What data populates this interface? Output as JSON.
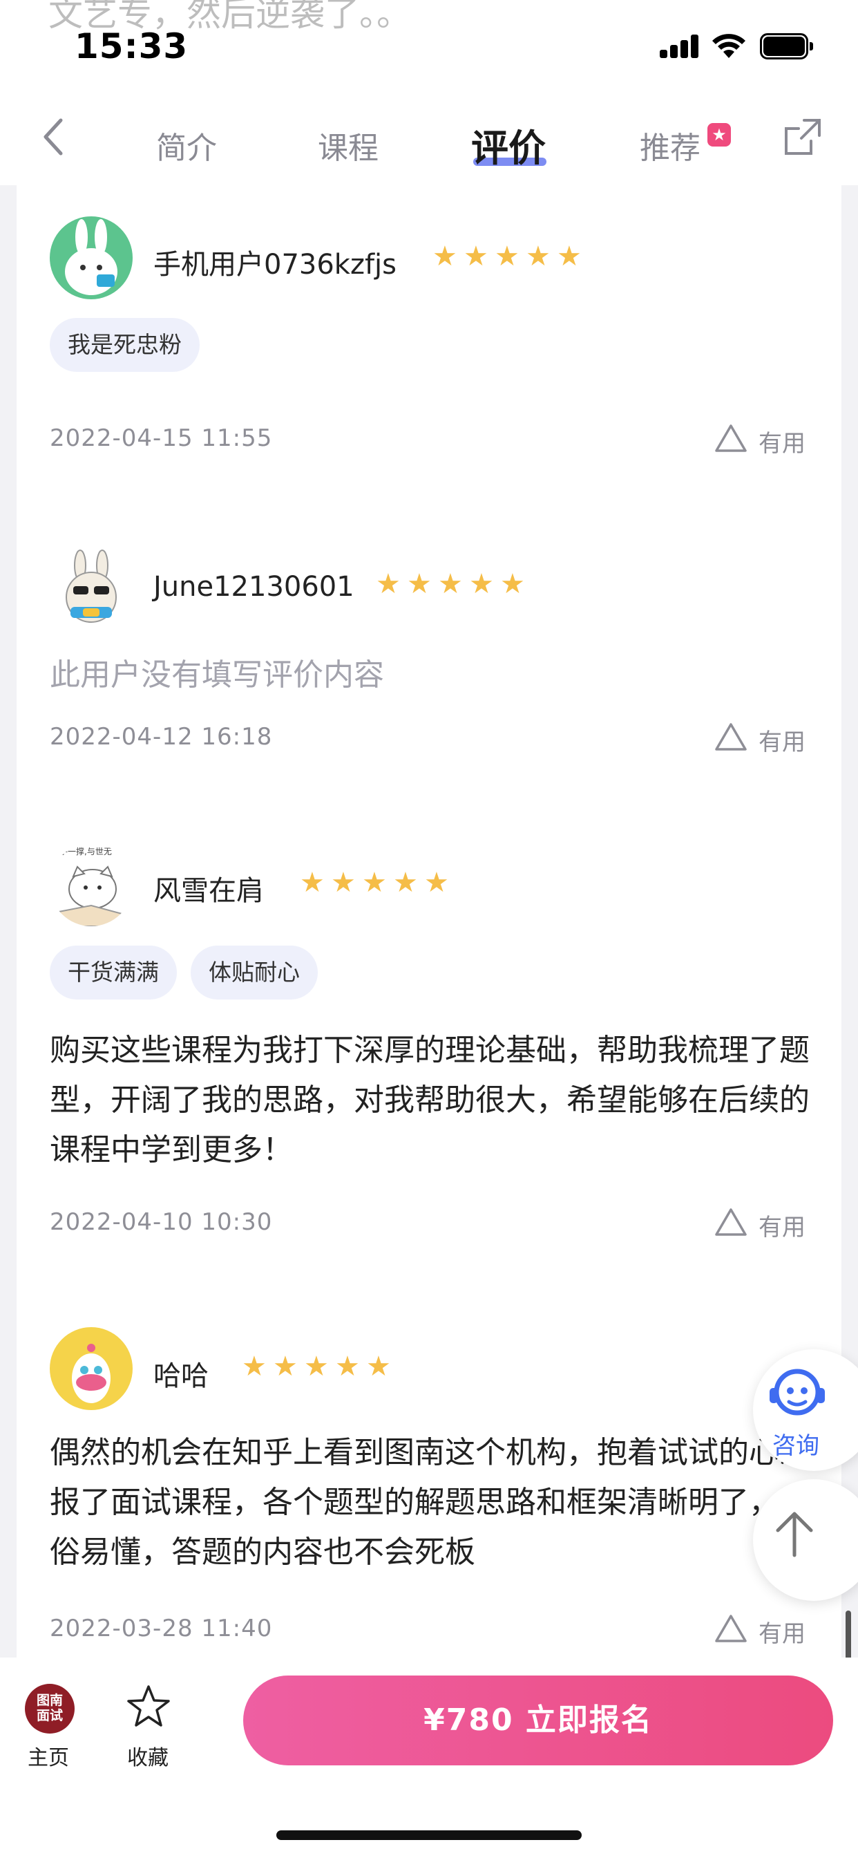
{
  "status_bar": {
    "time": "15:33",
    "bleed_text": "文艺专，然后逆袭了。。"
  },
  "nav": {
    "tabs": [
      {
        "label": "简介",
        "active": false
      },
      {
        "label": "课程",
        "active": false
      },
      {
        "label": "评价",
        "active": true
      },
      {
        "label": "推荐",
        "active": false
      }
    ],
    "recommend_badge": "★",
    "accent_color": "#7d8cf2"
  },
  "reviews": [
    {
      "user": "手机用户0736kzfjs",
      "avatar": "bunny-avatar",
      "rating": 5,
      "tags": [
        "我是死忠粉"
      ],
      "text": "",
      "date": "2022-04-15 11:55",
      "useful_label": "有用"
    },
    {
      "user": "June12130601",
      "avatar": "sunglasses-bunny-avatar",
      "rating": 5,
      "tags": [],
      "text": "此用户没有填写评价内容",
      "date": "2022-04-12 16:18",
      "useful_label": "有用"
    },
    {
      "user": "风雪在肩",
      "avatar": "cat-avatar",
      "rating": 5,
      "tags": [
        "干货满满",
        "体贴耐心"
      ],
      "text": "购买这些课程为我打下深厚的理论基础，帮助我梳理了题型，开阔了我的思路，对我帮助很大，希望能够在后续的课程中学到更多！",
      "date": "2022-04-10 10:30",
      "useful_label": "有用"
    },
    {
      "user": "哈哈",
      "avatar": "yellow-cartoon-avatar",
      "rating": 5,
      "tags": [],
      "text": "偶然的机会在知乎上看到图南这个机构，抱着试试的心态报了面试课程，各个题型的解题思路和框架清晰明了，通俗易懂，答题的内容也不会死板",
      "date": "2022-03-28 11:40",
      "useful_label": "有用"
    }
  ],
  "floating": {
    "consult_label": "咨询",
    "consult_color": "#3f6cf0"
  },
  "bottom_bar": {
    "home_logo_text": "图南面试",
    "home_label": "主页",
    "favorite_label": "收藏",
    "enroll_label": "¥780 立即报名",
    "enroll_color": "#ec4b7f"
  }
}
